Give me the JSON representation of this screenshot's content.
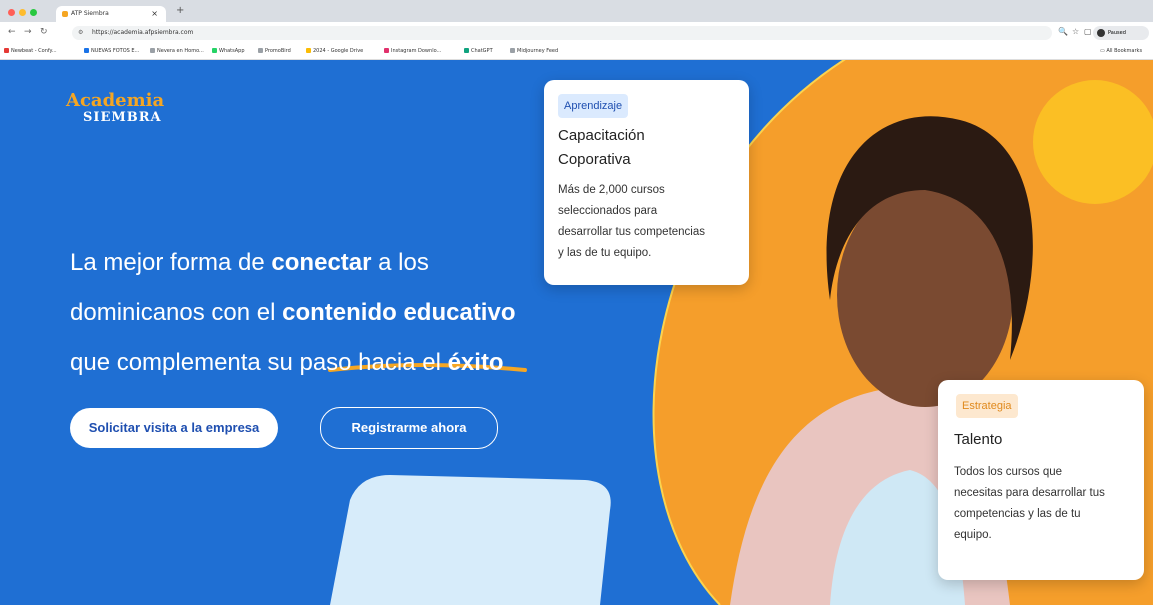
{
  "browser": {
    "tab_title": "ATP Siembra",
    "tab_close": "×",
    "new_tab": "+",
    "url": "https://academia.afpsiembra.com",
    "profile": "Paused",
    "bookmarks": [
      {
        "label": "Newbeat - Confy...",
        "color": "#e53935"
      },
      {
        "label": "NUEVAS FOTOS E...",
        "color": "#1a73e8"
      },
      {
        "label": "Nevera en Homo...",
        "color": "#9aa0a6"
      },
      {
        "label": "WhatsApp",
        "color": "#25d366"
      },
      {
        "label": "PromoBird",
        "color": "#9aa0a6"
      },
      {
        "label": "2024 - Google Drive",
        "color": "#fbbc05"
      },
      {
        "label": "Instagram Downlo...",
        "color": "#e1306c"
      },
      {
        "label": "ChatGPT",
        "color": "#10a37f"
      },
      {
        "label": "Midjourney Feed",
        "color": "#9aa0a6"
      }
    ],
    "all_bookmarks": "All Bookmarks"
  },
  "hero": {
    "logo_line1": "Academia",
    "logo_line2": "SIEMBRA",
    "headline": {
      "l1a": "La mejor forma de ",
      "l1b": "conectar",
      "l1c": " a los",
      "l2a": "dominicanos con el ",
      "l2b": "contenido educativo",
      "l3a": "que complementa su ",
      "l3b": "paso hacia el ",
      "l3c": "éxito"
    },
    "primary_button": "Solicitar visita a la empresa",
    "secondary_button": "Registrarme ahora"
  },
  "cards": [
    {
      "tag": "Aprendizaje",
      "title": [
        "Capacitación",
        "Coporativa"
      ],
      "body": [
        "Más de 2,000 cursos",
        "seleccionados para",
        "desarrollar tus competencias",
        "y las de tu equipo."
      ]
    },
    {
      "tag": "Estrategia",
      "title": [
        "Talento"
      ],
      "body": [
        "Todos los cursos que",
        "necesitas para desarrollar tus",
        "competencias y las de tu",
        "equipo."
      ]
    }
  ],
  "colors": {
    "hero_blue": "#1f6fd3",
    "accent_orange": "#f5a623",
    "sun_yellow": "#fbbf24"
  }
}
